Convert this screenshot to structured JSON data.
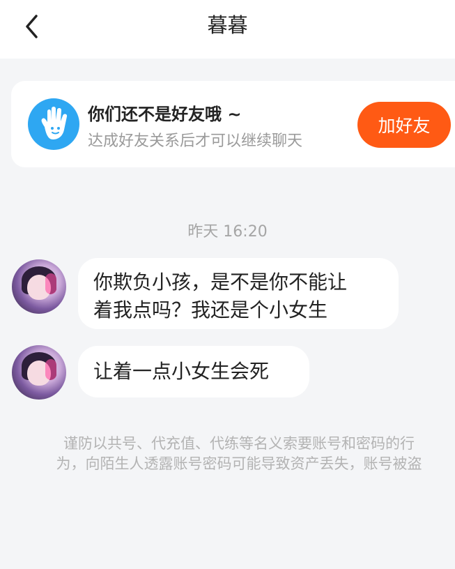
{
  "header": {
    "title": "暮暮",
    "back_icon": "chevron-left-icon"
  },
  "friend_card": {
    "icon": "hand-wave-icon",
    "title": "你们还不是好友哦 ~",
    "subtitle": "达成好友关系后才可以继续聊天",
    "add_button": "加好友",
    "accent_color": "#ff5a14"
  },
  "chat": {
    "timestamp": "昨天 16:20",
    "messages": [
      {
        "line1": "你欺负小孩，是不是你不能让",
        "line2": "着我点吗？我还是个小女生"
      },
      {
        "line1": "让着一点小女生会死"
      }
    ]
  },
  "notice": {
    "line1": "谨防以共号、代充值、代练等名义索要账号和密码的行",
    "line2": "为，向陌生人透露账号密码可能导致资产丢失，账号被盗"
  }
}
